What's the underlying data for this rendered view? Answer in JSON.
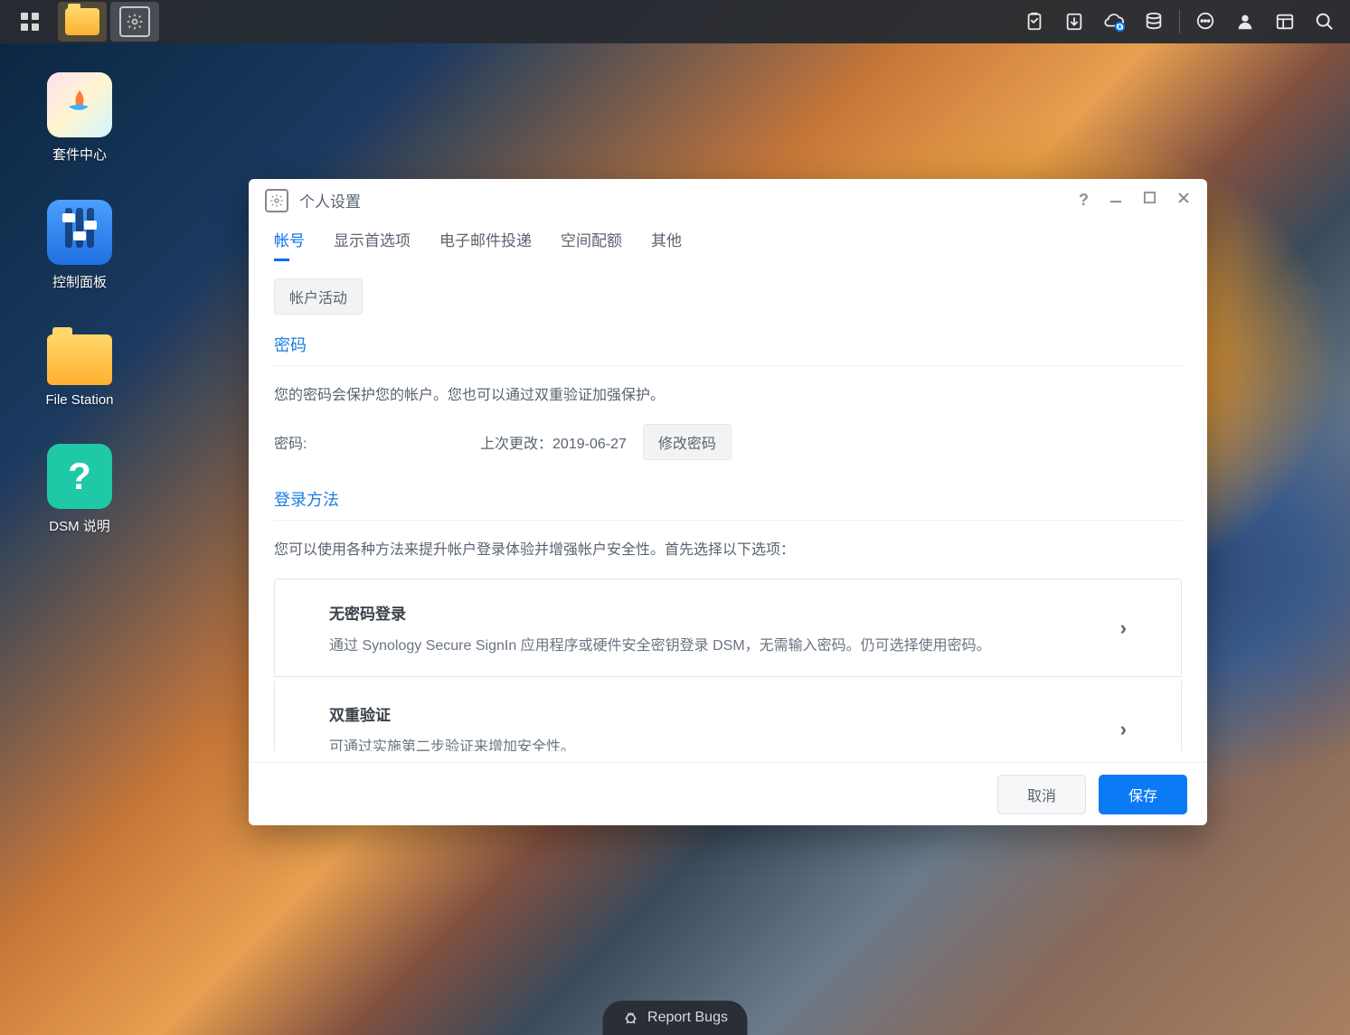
{
  "desktop": {
    "icons": [
      {
        "id": "package-center",
        "label": "套件中心"
      },
      {
        "id": "control-panel",
        "label": "控制面板"
      },
      {
        "id": "file-station",
        "label": "File Station"
      },
      {
        "id": "dsm-help",
        "label": "DSM 说明"
      }
    ]
  },
  "window": {
    "title": "个人设置",
    "tabs": [
      {
        "id": "account",
        "label": "帐号",
        "active": true
      },
      {
        "id": "display",
        "label": "显示首选项"
      },
      {
        "id": "email",
        "label": "电子邮件投递"
      },
      {
        "id": "quota",
        "label": "空间配额"
      },
      {
        "id": "other",
        "label": "其他"
      }
    ],
    "account_activity_btn": "帐户活动",
    "password_section": {
      "title": "密码",
      "desc": "您的密码会保护您的帐户。您也可以通过双重验证加强保护。",
      "label": "密码:",
      "last_changed_label": "上次更改：",
      "last_changed_value": "2019-06-27",
      "change_btn": "修改密码"
    },
    "signin_section": {
      "title": "登录方法",
      "desc": "您可以使用各种方法来提升帐户登录体验并增强帐户安全性。首先选择以下选项：",
      "items": [
        {
          "title": "无密码登录",
          "desc": "通过 Synology Secure SignIn 应用程序或硬件安全密钥登录 DSM，无需输入密码。仍可选择使用密码。"
        },
        {
          "title": "双重验证",
          "desc": "可通过实施第二步验证来增加安全性。"
        }
      ]
    },
    "footer": {
      "cancel": "取消",
      "save": "保存"
    }
  },
  "report_bugs": "Report Bugs"
}
